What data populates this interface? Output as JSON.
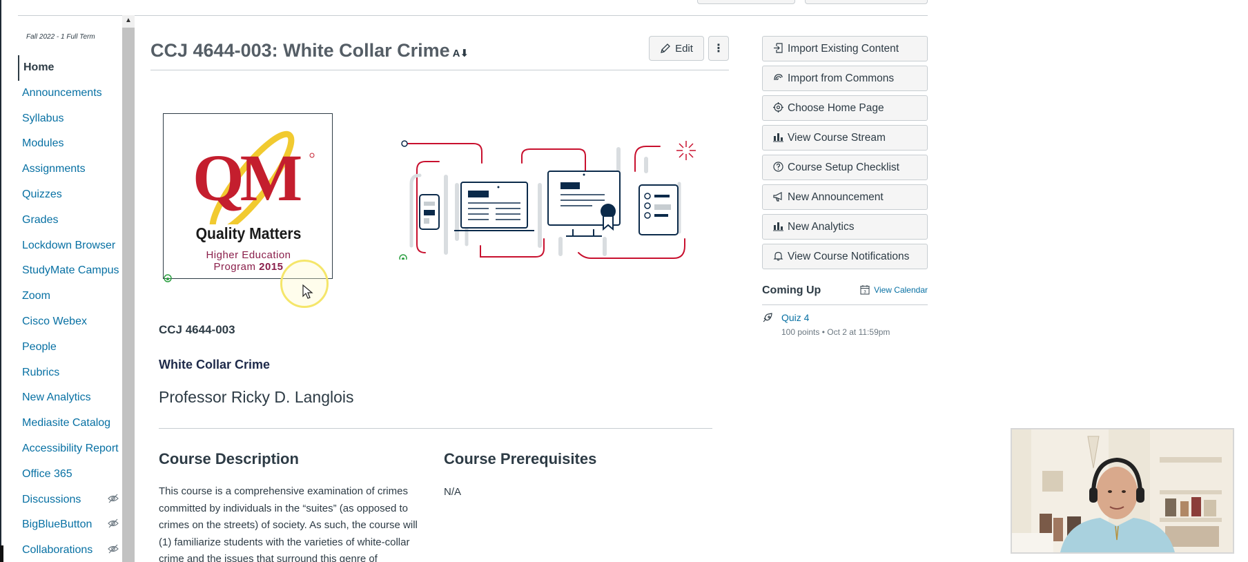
{
  "course_nav": {
    "term": "Fall 2022 - 1 Full Term",
    "items": [
      {
        "label": "Home",
        "active": true,
        "hidden": false
      },
      {
        "label": "Announcements",
        "active": false,
        "hidden": false
      },
      {
        "label": "Syllabus",
        "active": false,
        "hidden": false
      },
      {
        "label": "Modules",
        "active": false,
        "hidden": false
      },
      {
        "label": "Assignments",
        "active": false,
        "hidden": false
      },
      {
        "label": "Quizzes",
        "active": false,
        "hidden": false
      },
      {
        "label": "Grades",
        "active": false,
        "hidden": false
      },
      {
        "label": "Lockdown Browser",
        "active": false,
        "hidden": false
      },
      {
        "label": "StudyMate Campus",
        "active": false,
        "hidden": false
      },
      {
        "label": "Zoom",
        "active": false,
        "hidden": false
      },
      {
        "label": "Cisco Webex",
        "active": false,
        "hidden": false
      },
      {
        "label": "People",
        "active": false,
        "hidden": false
      },
      {
        "label": "Rubrics",
        "active": false,
        "hidden": false
      },
      {
        "label": "New Analytics",
        "active": false,
        "hidden": false
      },
      {
        "label": "Mediasite Catalog",
        "active": false,
        "hidden": false
      },
      {
        "label": "Accessibility Report",
        "active": false,
        "hidden": false
      },
      {
        "label": "Office 365",
        "active": false,
        "hidden": false
      },
      {
        "label": "Discussions",
        "active": false,
        "hidden": true
      },
      {
        "label": "BigBlueButton",
        "active": false,
        "hidden": true
      },
      {
        "label": "Collaborations",
        "active": false,
        "hidden": true
      }
    ]
  },
  "header": {
    "title": "CCJ 4644-003: White Collar Crime",
    "edit_label": "Edit"
  },
  "qm_logo": {
    "letters": "QM",
    "tagline": "Quality Matters",
    "sub1": "Higher Education",
    "sub2_prefix": "Program ",
    "sub2_year": "2015"
  },
  "content": {
    "course_code": "CCJ 4644-003",
    "course_name": "White Collar Crime",
    "professor": "Professor Ricky D. Langlois",
    "description_heading": "Course Description",
    "prerequisites_heading": "Course Prerequisites",
    "prerequisites_value": "N/A",
    "description_text": "This course is a comprehensive examination of crimes committed by individuals in the “suites” (as opposed to crimes on the streets) of society. As such, the course will (1) familiarize students with the varieties of white-collar crime and the issues that surround this genre of"
  },
  "sidebar_actions": [
    {
      "label": "Import Existing Content",
      "icon": "import-icon"
    },
    {
      "label": "Import from Commons",
      "icon": "commons-icon"
    },
    {
      "label": "Choose Home Page",
      "icon": "target-icon"
    },
    {
      "label": "View Course Stream",
      "icon": "bar-chart-icon"
    },
    {
      "label": "Course Setup Checklist",
      "icon": "question-icon"
    },
    {
      "label": "New Announcement",
      "icon": "megaphone-icon"
    },
    {
      "label": "New Analytics",
      "icon": "bar-chart-icon"
    },
    {
      "label": "View Course Notifications",
      "icon": "bell-icon"
    }
  ],
  "coming_up": {
    "title": "Coming Up",
    "view_calendar": "View Calendar",
    "calendar_day": "3",
    "items": [
      {
        "title": "Quiz 4",
        "meta": "100 points • Oct 2 at 11:59pm"
      }
    ]
  },
  "colors": {
    "link": "#0770a3",
    "text": "#2d3b45",
    "qm_red": "#c41e2e",
    "qm_gold": "#f0c419",
    "illus_red": "#c8102e",
    "illus_navy": "#0b2a4a"
  }
}
